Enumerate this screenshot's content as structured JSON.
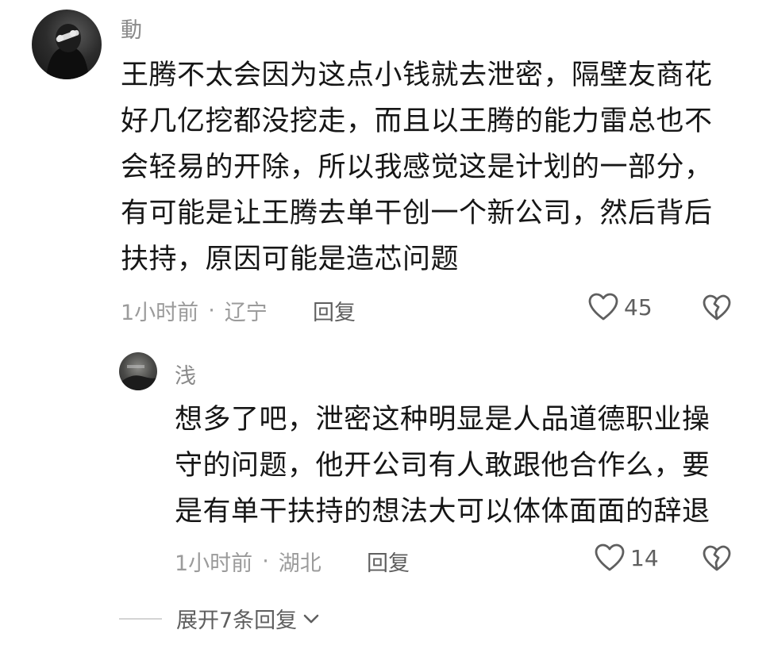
{
  "comment": {
    "username": "動",
    "text_lines": [
      "王腾不太会因为这点小钱就去泄密，隔壁友商花",
      "好几亿挖都没挖走，而且以王腾的能力雷总也不",
      "会轻易的开除，所以我感觉这是计划的一部分，",
      "有可能是让王腾去单干创一个新公司，然后背后",
      "扶持，原因可能是造芯问题"
    ],
    "time": "1小时前",
    "separator": "·",
    "location": "辽宁",
    "reply_label": "回复",
    "like_count": "45"
  },
  "reply": {
    "username": "浅",
    "text_lines": [
      "想多了吧，泄密这种明显是人品道德职业操",
      "守的问题，他开公司有人敢跟他合作么，要",
      "是有单干扶持的想法大可以体体面面的辞退"
    ],
    "time": "1小时前",
    "separator": "·",
    "location": "湖北",
    "reply_label": "回复",
    "like_count": "14"
  },
  "expand_replies": {
    "label": "展开7条回复"
  }
}
